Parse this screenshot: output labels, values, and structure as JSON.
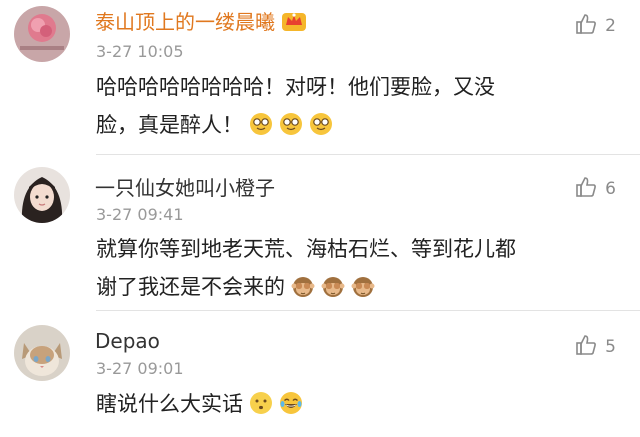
{
  "comments": [
    {
      "username": "泰山顶上的一缕晨曦",
      "time": "3-27 10:05",
      "likes": "2",
      "line1": "哈哈哈哈哈哈哈哈！对呀！他们要脸，又没",
      "line2": "脸，真是醉人！",
      "emojis": [
        "nerd-emoji",
        "nerd-emoji",
        "nerd-emoji"
      ],
      "badge": "vip-crown-icon"
    },
    {
      "username": "一只仙女她叫小橙子",
      "time": "3-27 09:41",
      "likes": "6",
      "line1": "就算你等到地老天荒、海枯石烂、等到花儿都",
      "line2": "谢了我还是不会来的",
      "emojis": [
        "see-no-evil-monkey-emoji",
        "see-no-evil-monkey-emoji",
        "see-no-evil-monkey-emoji"
      ]
    },
    {
      "username": "Depao",
      "time": "3-27 09:01",
      "likes": "5",
      "line1": "瞎说什么大实话",
      "emojis": [
        "confused-face-emoji",
        "laughing-tears-emoji"
      ]
    }
  ],
  "colors": {
    "username_vip": "#e0781f",
    "time": "#999999",
    "divider": "#e3e3e3"
  }
}
